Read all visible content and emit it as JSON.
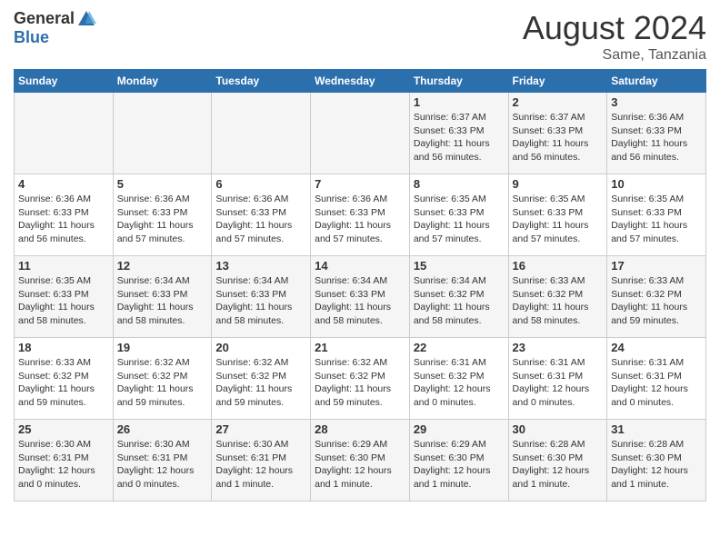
{
  "logo": {
    "general": "General",
    "blue": "Blue"
  },
  "title": {
    "month_year": "August 2024",
    "location": "Same, Tanzania"
  },
  "header_days": [
    "Sunday",
    "Monday",
    "Tuesday",
    "Wednesday",
    "Thursday",
    "Friday",
    "Saturday"
  ],
  "weeks": [
    [
      {
        "day": "",
        "info": ""
      },
      {
        "day": "",
        "info": ""
      },
      {
        "day": "",
        "info": ""
      },
      {
        "day": "",
        "info": ""
      },
      {
        "day": "1",
        "info": "Sunrise: 6:37 AM\nSunset: 6:33 PM\nDaylight: 11 hours and 56 minutes."
      },
      {
        "day": "2",
        "info": "Sunrise: 6:37 AM\nSunset: 6:33 PM\nDaylight: 11 hours and 56 minutes."
      },
      {
        "day": "3",
        "info": "Sunrise: 6:36 AM\nSunset: 6:33 PM\nDaylight: 11 hours and 56 minutes."
      }
    ],
    [
      {
        "day": "4",
        "info": "Sunrise: 6:36 AM\nSunset: 6:33 PM\nDaylight: 11 hours and 56 minutes."
      },
      {
        "day": "5",
        "info": "Sunrise: 6:36 AM\nSunset: 6:33 PM\nDaylight: 11 hours and 57 minutes."
      },
      {
        "day": "6",
        "info": "Sunrise: 6:36 AM\nSunset: 6:33 PM\nDaylight: 11 hours and 57 minutes."
      },
      {
        "day": "7",
        "info": "Sunrise: 6:36 AM\nSunset: 6:33 PM\nDaylight: 11 hours and 57 minutes."
      },
      {
        "day": "8",
        "info": "Sunrise: 6:35 AM\nSunset: 6:33 PM\nDaylight: 11 hours and 57 minutes."
      },
      {
        "day": "9",
        "info": "Sunrise: 6:35 AM\nSunset: 6:33 PM\nDaylight: 11 hours and 57 minutes."
      },
      {
        "day": "10",
        "info": "Sunrise: 6:35 AM\nSunset: 6:33 PM\nDaylight: 11 hours and 57 minutes."
      }
    ],
    [
      {
        "day": "11",
        "info": "Sunrise: 6:35 AM\nSunset: 6:33 PM\nDaylight: 11 hours and 58 minutes."
      },
      {
        "day": "12",
        "info": "Sunrise: 6:34 AM\nSunset: 6:33 PM\nDaylight: 11 hours and 58 minutes."
      },
      {
        "day": "13",
        "info": "Sunrise: 6:34 AM\nSunset: 6:33 PM\nDaylight: 11 hours and 58 minutes."
      },
      {
        "day": "14",
        "info": "Sunrise: 6:34 AM\nSunset: 6:33 PM\nDaylight: 11 hours and 58 minutes."
      },
      {
        "day": "15",
        "info": "Sunrise: 6:34 AM\nSunset: 6:32 PM\nDaylight: 11 hours and 58 minutes."
      },
      {
        "day": "16",
        "info": "Sunrise: 6:33 AM\nSunset: 6:32 PM\nDaylight: 11 hours and 58 minutes."
      },
      {
        "day": "17",
        "info": "Sunrise: 6:33 AM\nSunset: 6:32 PM\nDaylight: 11 hours and 59 minutes."
      }
    ],
    [
      {
        "day": "18",
        "info": "Sunrise: 6:33 AM\nSunset: 6:32 PM\nDaylight: 11 hours and 59 minutes."
      },
      {
        "day": "19",
        "info": "Sunrise: 6:32 AM\nSunset: 6:32 PM\nDaylight: 11 hours and 59 minutes."
      },
      {
        "day": "20",
        "info": "Sunrise: 6:32 AM\nSunset: 6:32 PM\nDaylight: 11 hours and 59 minutes."
      },
      {
        "day": "21",
        "info": "Sunrise: 6:32 AM\nSunset: 6:32 PM\nDaylight: 11 hours and 59 minutes."
      },
      {
        "day": "22",
        "info": "Sunrise: 6:31 AM\nSunset: 6:32 PM\nDaylight: 12 hours and 0 minutes."
      },
      {
        "day": "23",
        "info": "Sunrise: 6:31 AM\nSunset: 6:31 PM\nDaylight: 12 hours and 0 minutes."
      },
      {
        "day": "24",
        "info": "Sunrise: 6:31 AM\nSunset: 6:31 PM\nDaylight: 12 hours and 0 minutes."
      }
    ],
    [
      {
        "day": "25",
        "info": "Sunrise: 6:30 AM\nSunset: 6:31 PM\nDaylight: 12 hours and 0 minutes."
      },
      {
        "day": "26",
        "info": "Sunrise: 6:30 AM\nSunset: 6:31 PM\nDaylight: 12 hours and 0 minutes."
      },
      {
        "day": "27",
        "info": "Sunrise: 6:30 AM\nSunset: 6:31 PM\nDaylight: 12 hours and 1 minute."
      },
      {
        "day": "28",
        "info": "Sunrise: 6:29 AM\nSunset: 6:30 PM\nDaylight: 12 hours and 1 minute."
      },
      {
        "day": "29",
        "info": "Sunrise: 6:29 AM\nSunset: 6:30 PM\nDaylight: 12 hours and 1 minute."
      },
      {
        "day": "30",
        "info": "Sunrise: 6:28 AM\nSunset: 6:30 PM\nDaylight: 12 hours and 1 minute."
      },
      {
        "day": "31",
        "info": "Sunrise: 6:28 AM\nSunset: 6:30 PM\nDaylight: 12 hours and 1 minute."
      }
    ]
  ]
}
